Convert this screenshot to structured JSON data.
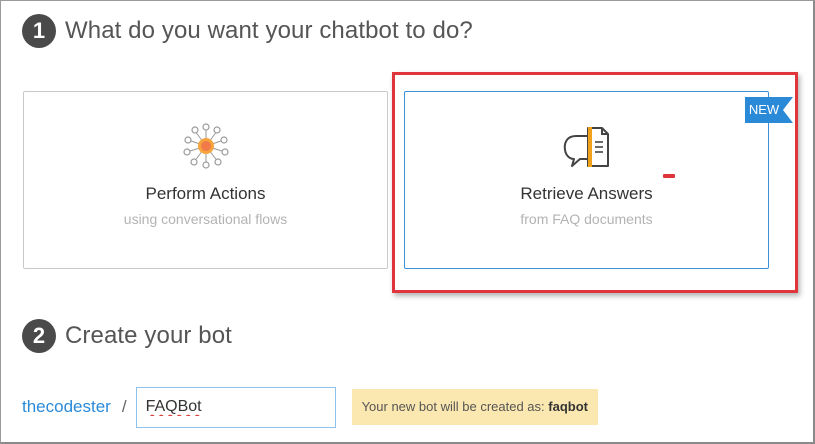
{
  "step1": {
    "number": "1",
    "title": "What do you want your chatbot to do?"
  },
  "cards": {
    "actions": {
      "title": "Perform Actions",
      "subtitle": "using conversational flows",
      "icon": "network-nodes-icon"
    },
    "answers": {
      "title": "Retrieve Answers",
      "subtitle": "from FAQ documents",
      "icon": "chat-document-icon",
      "badge": "NEW"
    }
  },
  "step2": {
    "number": "2",
    "title": "Create your bot"
  },
  "bot": {
    "owner": "thecodester",
    "separator": "/",
    "name_value": "FAQBot",
    "hint_prefix": "Your new bot will be created as:",
    "hint_name": "faqbot"
  },
  "colors": {
    "accent": "#2b8ad8",
    "highlight": "#e0353b",
    "hint_bg": "#fbe8b0"
  }
}
